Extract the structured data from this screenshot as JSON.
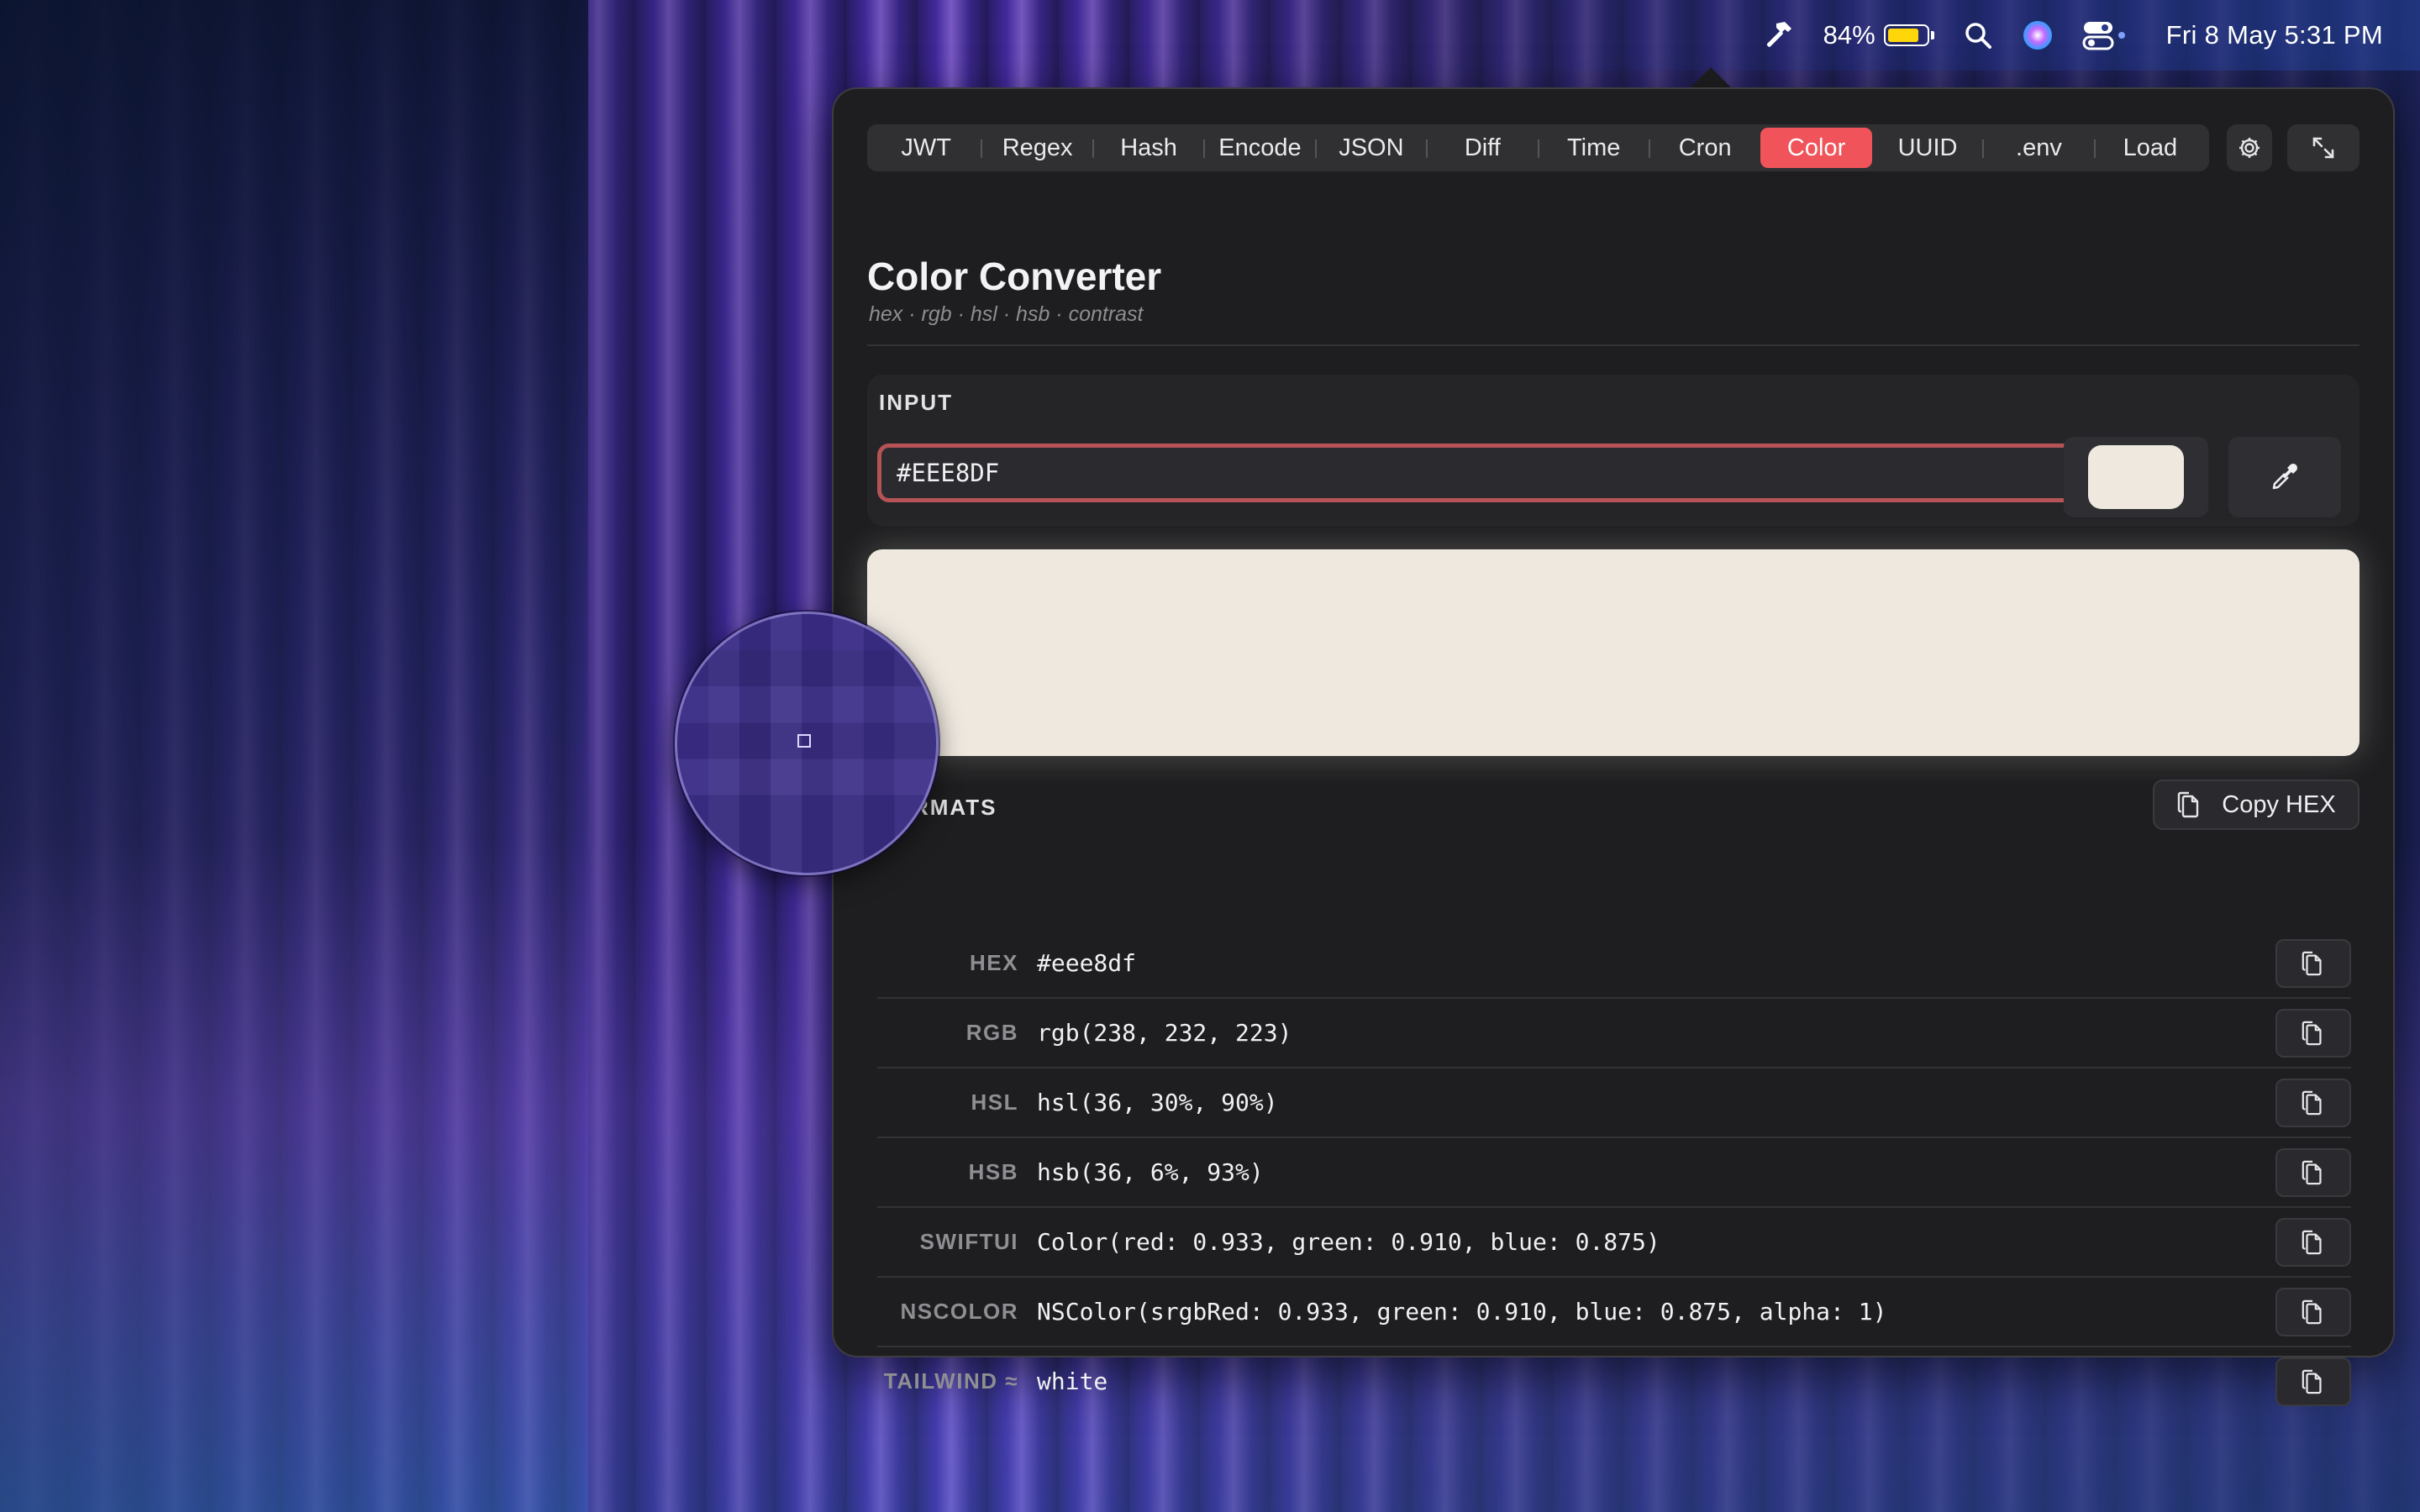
{
  "menubar": {
    "battery_percent": "84%",
    "battery_level": 0.84,
    "clock": "Fri 8 May  5:31 PM",
    "icons": [
      "hammer-icon",
      "battery-charging-icon",
      "search-icon",
      "siri-icon",
      "control-center-icon"
    ]
  },
  "tabs": [
    {
      "label": "JWT"
    },
    {
      "label": "Regex"
    },
    {
      "label": "Hash"
    },
    {
      "label": "Encode"
    },
    {
      "label": "JSON"
    },
    {
      "label": "Diff"
    },
    {
      "label": "Time"
    },
    {
      "label": "Cron"
    },
    {
      "label": "Color",
      "active": true
    },
    {
      "label": "UUID"
    },
    {
      "label": ".env"
    },
    {
      "label": "Load"
    }
  ],
  "toolbar_icons": [
    "gear-icon",
    "expand-icon"
  ],
  "header": {
    "title": "Color Converter",
    "subtitle": "hex · rgb · hsl · hsb · contrast"
  },
  "input": {
    "section_label": "INPUT",
    "value": "#EEE8DF",
    "swatch_color": "#eee8df"
  },
  "formats": {
    "section_label": "RMATS",
    "copy_button_label": "Copy HEX",
    "rows": [
      {
        "label": "HEX",
        "value": "#eee8df"
      },
      {
        "label": "RGB",
        "value": "rgb(238, 232, 223)"
      },
      {
        "label": "HSL",
        "value": "hsl(36, 30%, 90%)"
      },
      {
        "label": "HSB",
        "value": "hsb(36, 6%, 93%)"
      },
      {
        "label": "SWIFTUI",
        "value": "Color(red: 0.933, green: 0.910, blue: 0.875)"
      },
      {
        "label": "NSCOLOR",
        "value": "NSColor(srgbRed: 0.933, green: 0.910, blue: 0.875, alpha: 1)"
      },
      {
        "label": "TAILWIND ≈",
        "value": "white"
      }
    ]
  },
  "colors": {
    "accent": "#f0535a",
    "panel": "#1e1e20",
    "preview": "#eee8df"
  }
}
